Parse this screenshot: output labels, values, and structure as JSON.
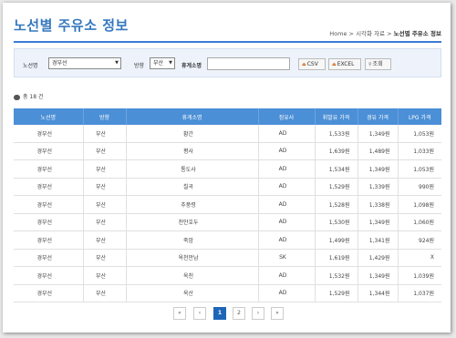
{
  "title": "노선별 주유소 정보",
  "breadcrumb": [
    "Home",
    "시각화 자료",
    "노선별 주유소 정보"
  ],
  "filters": {
    "route_label": "노선명",
    "route_value": "경부선",
    "direction_label": "방향",
    "direction_value": "부산",
    "rest_label": "휴게소명",
    "rest_value": "",
    "csv": "CSV",
    "excel": "EXCEL",
    "search": "조회"
  },
  "count_text": "총 18 건",
  "table": {
    "headers": [
      "노선명",
      "방향",
      "휴게소명",
      "정유사",
      "휘발유 가격",
      "경유 가격",
      "LPG 가격"
    ],
    "rows": [
      [
        "경부선",
        "부산",
        "황간",
        "AD",
        "1,533원",
        "1,349원",
        "1,053원"
      ],
      [
        "경부선",
        "부산",
        "평사",
        "AD",
        "1,639원",
        "1,489원",
        "1,033원"
      ],
      [
        "경부선",
        "부산",
        "통도사",
        "AD",
        "1,534원",
        "1,349원",
        "1,053원"
      ],
      [
        "경부선",
        "부산",
        "칠곡",
        "AD",
        "1,529원",
        "1,339원",
        "990원"
      ],
      [
        "경부선",
        "부산",
        "추풍령",
        "AD",
        "1,528원",
        "1,338원",
        "1,098원"
      ],
      [
        "경부선",
        "부산",
        "천안호두",
        "AD",
        "1,530원",
        "1,349원",
        "1,060원"
      ],
      [
        "경부선",
        "부산",
        "죽암",
        "AD",
        "1,499원",
        "1,341원",
        "924원"
      ],
      [
        "경부선",
        "부산",
        "옥천만남",
        "SK",
        "1,619원",
        "1,429원",
        "X"
      ],
      [
        "경부선",
        "부산",
        "옥천",
        "AD",
        "1,532원",
        "1,349원",
        "1,039원"
      ],
      [
        "경부선",
        "부산",
        "옥산",
        "AD",
        "1,529원",
        "1,344원",
        "1,037원"
      ]
    ]
  },
  "pagination": {
    "first": "«",
    "prev": "‹",
    "pages": [
      "1",
      "2"
    ],
    "current": "1",
    "next": "›",
    "last": "»"
  }
}
